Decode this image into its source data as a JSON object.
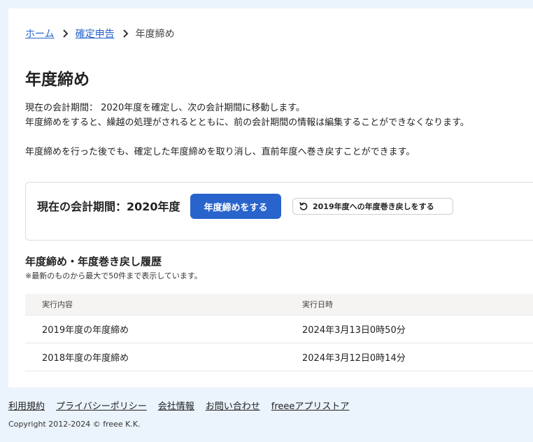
{
  "breadcrumb": {
    "home": "ホーム",
    "tax_return": "確定申告",
    "current": "年度締め"
  },
  "page": {
    "title": "年度締め",
    "description_line1": "現在の会計期間： 2020年度を確定し、次の会計期間に移動します。",
    "description_line2": "年度締めをすると、繰越の処理がされるとともに、前の会計期間の情報は編集することができなくなります。",
    "description_line3": "年度締めを行った後でも、確定した年度締めを取り消し、直前年度へ巻き戻すことができます。"
  },
  "period": {
    "label": "現在の会計期間：2020年度",
    "close_button": "年度締めをする",
    "rollback_button": "2019年度への年度巻き戻しをする"
  },
  "history": {
    "title": "年度締め・年度巻き戻し履歴",
    "note": "※最新のものから最大で50件まで表示しています。",
    "columns": [
      "実行内容",
      "実行日時"
    ],
    "rows": [
      {
        "action": "2019年度の年度締め",
        "datetime": "2024年3月13日0時50分"
      },
      {
        "action": "2018年度の年度締め",
        "datetime": "2024年3月12日0時14分"
      }
    ]
  },
  "footer": {
    "links": [
      "利用規約",
      "プライバシーポリシー",
      "会社情報",
      "お問い合わせ",
      "freeeアプリストア"
    ],
    "copyright": "Copyright 2012-2024 © freee K.K."
  },
  "colors": {
    "page_background": "#ebf3fd",
    "primary": "#2864cc",
    "link": "#2864cc",
    "table_header": "#f5f4f2"
  },
  "icons": {
    "breadcrumb_separator": "chevron-right-icon",
    "rollback": "undo-icon"
  }
}
